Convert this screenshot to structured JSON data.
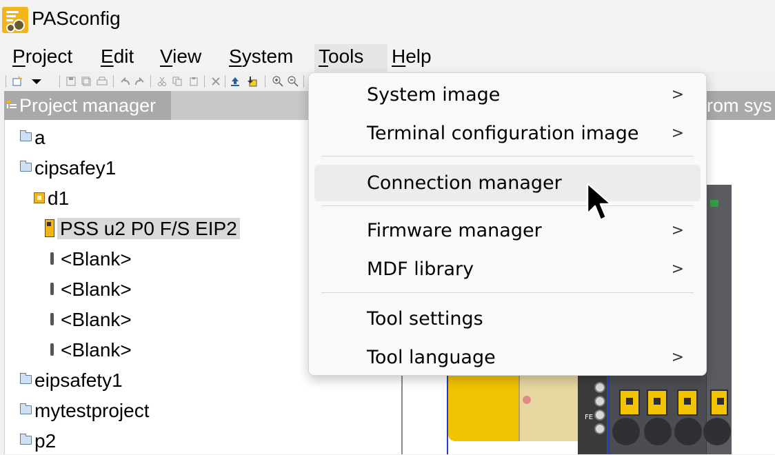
{
  "app": {
    "title": "PASconfig"
  },
  "menubar": {
    "items": [
      {
        "label": "Project",
        "mnemonic": "P",
        "rest": "roject"
      },
      {
        "label": "Edit",
        "mnemonic": "E",
        "rest": "dit"
      },
      {
        "label": "View",
        "mnemonic": "V",
        "rest": "iew"
      },
      {
        "label": "System",
        "mnemonic": "S",
        "rest": "ystem"
      },
      {
        "label": "Tools",
        "mnemonic": "T",
        "rest": "ools"
      },
      {
        "label": "Help",
        "mnemonic": "H",
        "rest": "elp"
      }
    ]
  },
  "toolbar": {
    "icons": [
      "new-project-icon",
      "dropdown-arrow-icon",
      "save-icon",
      "save-all-icon",
      "print-icon",
      "undo-icon",
      "redo-icon",
      "cut-icon",
      "copy-icon",
      "paste-icon",
      "delete-icon",
      "upload-icon",
      "download-icon",
      "zoom-in-icon",
      "zoom-out-icon"
    ]
  },
  "project_manager": {
    "title": "Project manager",
    "tree": [
      {
        "label": "a",
        "icon": "folder-icon"
      },
      {
        "label": "cipsafey1",
        "icon": "folder-icon"
      },
      {
        "label": "d1",
        "icon": "device-icon"
      },
      {
        "label": "PSS u2 P0 F/S EIP2",
        "icon": "pss-module-icon",
        "selected": true
      },
      {
        "label": "<Blank>",
        "icon": "blank-slot-icon"
      },
      {
        "label": "<Blank>",
        "icon": "blank-slot-icon"
      },
      {
        "label": "<Blank>",
        "icon": "blank-slot-icon"
      },
      {
        "label": "<Blank>",
        "icon": "blank-slot-icon"
      },
      {
        "label": "eipsafety1",
        "icon": "folder-icon"
      },
      {
        "label": "mytestproject",
        "icon": "folder-icon"
      },
      {
        "label": "p2",
        "icon": "folder-icon"
      }
    ]
  },
  "right_panel": {
    "title_fragment": "rom sys"
  },
  "tools_menu": {
    "items": [
      {
        "label": "System image",
        "submenu": true
      },
      {
        "label": "Terminal configuration image",
        "submenu": true
      },
      {
        "label": "Connection manager",
        "submenu": false,
        "hovered": true
      },
      {
        "label": "Firmware manager",
        "submenu": true
      },
      {
        "label": "MDF library",
        "submenu": true
      },
      {
        "label": "Tool settings",
        "submenu": false
      },
      {
        "label": "Tool language",
        "submenu": true
      }
    ],
    "arrow_glyph": ">"
  },
  "device": {
    "fe_label": "FE"
  },
  "colors": {
    "accent": "#f2b61c",
    "selection": "#d9d9d9",
    "panel_header": "#a9a9a9"
  }
}
